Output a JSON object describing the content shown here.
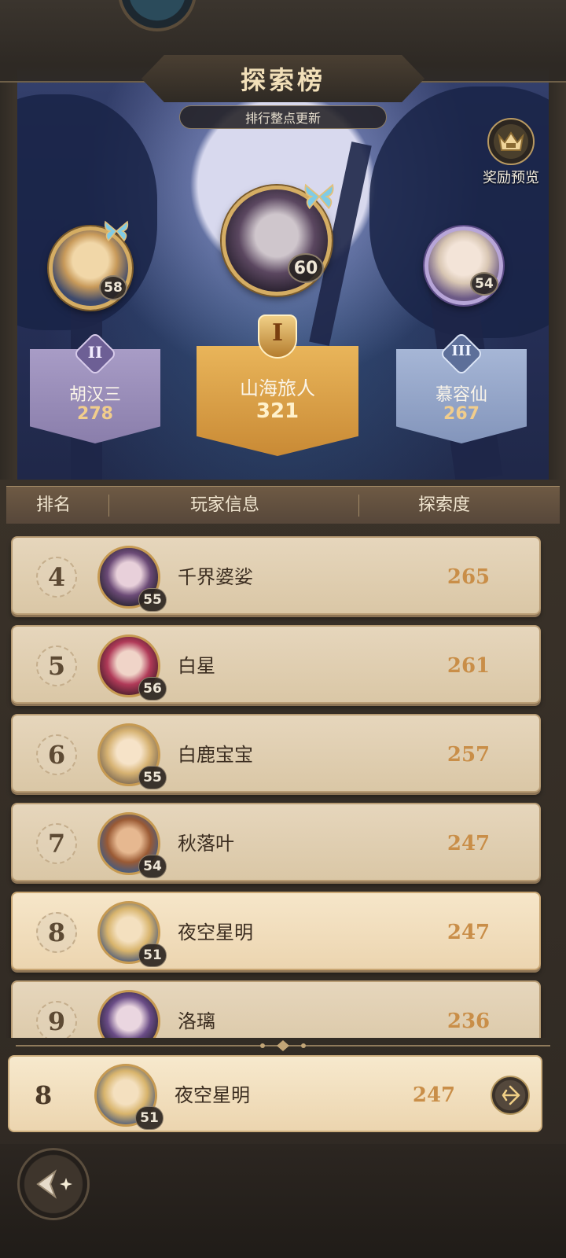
{
  "header": {
    "title": "探索榜",
    "subtitle": "排行整点更新",
    "reward_label": "奖励预览"
  },
  "podium": {
    "first": {
      "rank": "I",
      "name": "山海旅人",
      "score": "321",
      "level": "60"
    },
    "second": {
      "rank": "II",
      "name": "胡汉三",
      "score": "278",
      "level": "58"
    },
    "third": {
      "rank": "III",
      "name": "慕容仙",
      "score": "267",
      "level": "54"
    }
  },
  "table": {
    "col_rank": "排名",
    "col_player": "玩家信息",
    "col_score": "探索度"
  },
  "rows": [
    {
      "rank": "4",
      "name": "千界婆娑",
      "score": "265",
      "level": "55"
    },
    {
      "rank": "5",
      "name": "白星",
      "score": "261",
      "level": "56"
    },
    {
      "rank": "6",
      "name": "白鹿宝宝",
      "score": "257",
      "level": "55"
    },
    {
      "rank": "7",
      "name": "秋落叶",
      "score": "247",
      "level": "54"
    },
    {
      "rank": "8",
      "name": "夜空星明",
      "score": "247",
      "level": "51"
    },
    {
      "rank": "9",
      "name": "洛璃",
      "score": "236",
      "level": ""
    }
  ],
  "my_entry": {
    "rank": "8",
    "name": "夜空星明",
    "score": "247",
    "level": "51"
  },
  "colors": {
    "gold": "#d5ad63",
    "silver_podium": "#9b8fb3",
    "bronze_podium": "#8d9fc0",
    "score_text": "#c98e48"
  }
}
